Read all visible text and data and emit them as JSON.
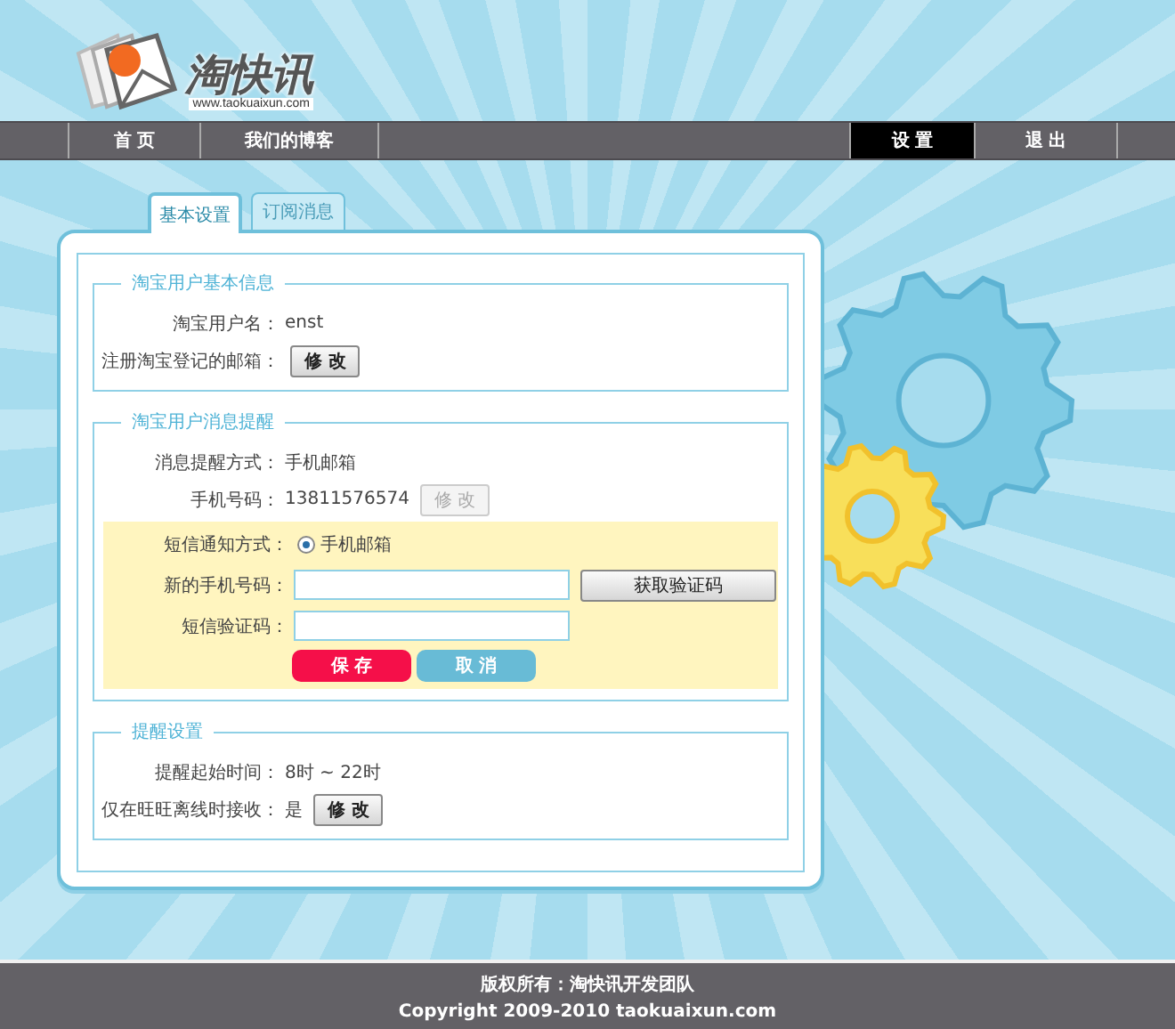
{
  "logo": {
    "name": "淘快讯",
    "url": "www.taokuaixun.com"
  },
  "nav": {
    "left": [
      {
        "label": "首 页",
        "selected": false
      },
      {
        "label": "我们的博客",
        "selected": false
      }
    ],
    "right": [
      {
        "label": "设 置",
        "selected": true
      },
      {
        "label": "退 出",
        "selected": false
      }
    ]
  },
  "tabs": [
    {
      "label": "基本设置",
      "selected": true
    },
    {
      "label": "订阅消息",
      "selected": false
    }
  ],
  "sections": [
    {
      "title": "淘宝用户基本信息",
      "rows": [
        {
          "label": "淘宝用户名：",
          "value": "enst"
        },
        {
          "label": "注册淘宝登记的邮箱：",
          "button": {
            "label": "修 改",
            "disabled": false
          }
        }
      ]
    },
    {
      "title": "淘宝用户消息提醒",
      "rows": [
        {
          "label": "消息提醒方式：",
          "value": "手机邮箱"
        },
        {
          "label": "手机号码：",
          "value": "13811576574",
          "button": {
            "label": "修 改",
            "disabled": true
          }
        }
      ],
      "sms_form": {
        "rows": [
          {
            "kind": "radio",
            "label": "短信通知方式：",
            "options": [
              {
                "label": "手机邮箱",
                "selected": true
              }
            ]
          },
          {
            "kind": "input",
            "label": "新的手机号码：",
            "button": {
              "label": "获取验证码",
              "disabled": false
            }
          },
          {
            "kind": "input",
            "label": "短信验证码："
          }
        ],
        "actions": [
          {
            "label": "保 存",
            "kind": "primary"
          },
          {
            "label": "取 消",
            "kind": "secondary"
          }
        ]
      }
    },
    {
      "title": "提醒设置",
      "rows": [
        {
          "label": "提醒起始时间：",
          "value": "8时 ~ 22时"
        },
        {
          "label": "仅在旺旺离线时接收：",
          "value": "是",
          "button": {
            "label": "修 改",
            "disabled": false
          }
        }
      ]
    }
  ],
  "footer": [
    "版权所有：淘快讯开发团队",
    "Copyright 2009-2010 taokuaixun.com"
  ]
}
